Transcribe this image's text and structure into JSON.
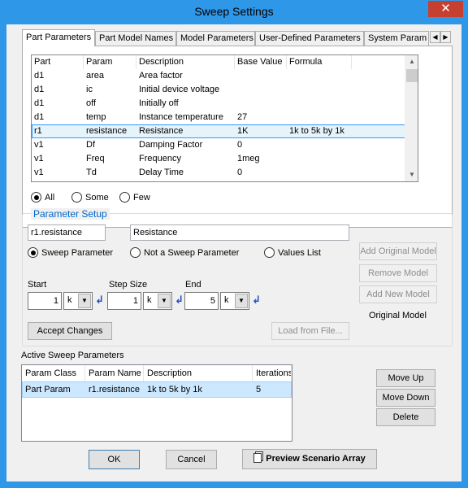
{
  "window": {
    "title": "Sweep Settings",
    "close_glyph": "✕"
  },
  "tabs": {
    "items": [
      "Part Parameters",
      "Part Model Names",
      "Model Parameters",
      "User-Defined  Parameters",
      "System Param"
    ],
    "active": "Part Parameters",
    "scroll_left": "◀",
    "scroll_right": "▶"
  },
  "param_grid": {
    "columns": [
      "Part",
      "Param",
      "Description",
      "Base Value",
      "Formula"
    ],
    "rows": [
      [
        "d1",
        "area",
        "Area factor",
        "",
        ""
      ],
      [
        "d1",
        "ic",
        "Initial device voltage",
        "",
        ""
      ],
      [
        "d1",
        "off",
        "Initially off",
        "",
        ""
      ],
      [
        "d1",
        "temp",
        "Instance temperature",
        "27",
        ""
      ],
      [
        "r1",
        "resistance",
        "Resistance",
        "1K",
        "1k to 5k by 1k"
      ],
      [
        "v1",
        "Df",
        "Damping Factor",
        "0",
        ""
      ],
      [
        "v1",
        "Freq",
        "Frequency",
        "1meg",
        ""
      ],
      [
        "v1",
        "Td",
        "Delay Time",
        "0",
        ""
      ]
    ],
    "selected_row": 4,
    "scroll_up": "▲",
    "scroll_down": "▼"
  },
  "filter": {
    "options": [
      "All",
      "Some",
      "Few"
    ],
    "selected": "All"
  },
  "parameter_setup": {
    "group_label": "Parameter Setup",
    "name_field": "r1.resistance",
    "description_field": "Resistance",
    "mode_options": [
      "Sweep Parameter",
      "Not a Sweep Parameter",
      "Values List"
    ],
    "mode_selected": "Sweep Parameter",
    "start": {
      "label": "Start",
      "value": "1",
      "unit": "k"
    },
    "step": {
      "label": "Step Size",
      "value": "1",
      "unit": "k"
    },
    "end": {
      "label": "End",
      "value": "5",
      "unit": "k"
    },
    "enter_glyph": "↲",
    "combo_arrow": "▼",
    "buttons": {
      "add_original_model": "Add Original Model",
      "remove_model": "Remove Model",
      "add_new_model": "Add New Model",
      "accept_changes": "Accept Changes",
      "load_from_file": "Load from File..."
    },
    "model_label": "Original Model"
  },
  "active_sweep": {
    "label": "Active Sweep Parameters",
    "columns": [
      "Param Class",
      "Param Name",
      "Description",
      "Iterations"
    ],
    "rows": [
      [
        "Part Param",
        "r1.resistance",
        "1k to 5k by 1k",
        "5"
      ]
    ],
    "buttons": {
      "move_up": "Move Up",
      "move_down": "Move Down",
      "delete": "Delete"
    }
  },
  "footer": {
    "ok": "OK",
    "cancel": "Cancel",
    "preview": "Preview Scenario Array"
  }
}
